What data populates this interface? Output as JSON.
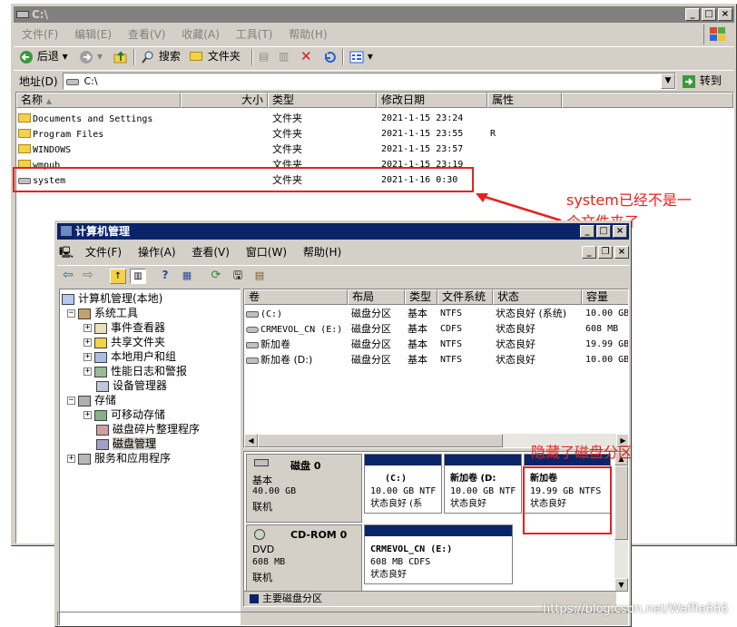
{
  "explorer": {
    "title": "C:\\",
    "menu": [
      "文件(F)",
      "编辑(E)",
      "查看(V)",
      "收藏(A)",
      "工具(T)",
      "帮助(H)"
    ],
    "toolbar": {
      "back": "后退",
      "search": "搜索",
      "folders": "文件夹"
    },
    "address_label": "地址(D)",
    "address_value": "C:\\",
    "go_label": "转到",
    "columns": [
      "名称",
      "大小",
      "类型",
      "修改日期",
      "属性"
    ],
    "rows": [
      {
        "name": "Documents and Settings",
        "size": "",
        "type": "文件夹",
        "date": "2021-1-15 23:24",
        "attr": ""
      },
      {
        "name": "Program Files",
        "size": "",
        "type": "文件夹",
        "date": "2021-1-15 23:55",
        "attr": "R"
      },
      {
        "name": "WINDOWS",
        "size": "",
        "type": "文件夹",
        "date": "2021-1-15 23:57",
        "attr": ""
      },
      {
        "name": "wmpub",
        "size": "",
        "type": "文件夹",
        "date": "2021-1-15 23:19",
        "attr": ""
      },
      {
        "name": "system",
        "size": "",
        "type": "文件夹",
        "date": "2021-1-16 0:30",
        "attr": ""
      }
    ]
  },
  "annotations": {
    "system_note_line1": "system已经不是一",
    "system_note_line2": "个文件夹了",
    "hidden_note": "隐藏了磁盘分区",
    "watermark": "https://blog.csdn.net/Waffle666"
  },
  "compmgmt": {
    "title": "计算机管理",
    "menu": [
      "文件(F)",
      "操作(A)",
      "查看(V)",
      "窗口(W)",
      "帮助(H)"
    ],
    "tree": [
      {
        "label": "计算机管理(本地)",
        "level": 0,
        "expander": ""
      },
      {
        "label": "系统工具",
        "level": 1,
        "expander": "−"
      },
      {
        "label": "事件查看器",
        "level": 2,
        "expander": "+"
      },
      {
        "label": "共享文件夹",
        "level": 2,
        "expander": "+"
      },
      {
        "label": "本地用户和组",
        "level": 2,
        "expander": "+"
      },
      {
        "label": "性能日志和警报",
        "level": 2,
        "expander": "+"
      },
      {
        "label": "设备管理器",
        "level": 2,
        "expander": ""
      },
      {
        "label": "存储",
        "level": 1,
        "expander": "−"
      },
      {
        "label": "可移动存储",
        "level": 2,
        "expander": "+"
      },
      {
        "label": "磁盘碎片整理程序",
        "level": 2,
        "expander": ""
      },
      {
        "label": "磁盘管理",
        "level": 2,
        "expander": ""
      },
      {
        "label": "服务和应用程序",
        "level": 1,
        "expander": "+"
      }
    ],
    "volume_columns": [
      "卷",
      "布局",
      "类型",
      "文件系统",
      "状态",
      "容量"
    ],
    "volumes": [
      {
        "name": "(C:)",
        "layout": "磁盘分区",
        "type": "基本",
        "fs": "NTFS",
        "status": "状态良好 (系统)",
        "cap": "10.00 GB"
      },
      {
        "name": "CRMEVOL_CN (E:)",
        "layout": "磁盘分区",
        "type": "基本",
        "fs": "CDFS",
        "status": "状态良好",
        "cap": "608 MB"
      },
      {
        "name": "新加卷",
        "layout": "磁盘分区",
        "type": "基本",
        "fs": "NTFS",
        "status": "状态良好",
        "cap": "19.99 GB"
      },
      {
        "name": "新加卷 (D:)",
        "layout": "磁盘分区",
        "type": "基本",
        "fs": "NTFS",
        "status": "状态良好",
        "cap": "10.00 GB"
      }
    ],
    "disks": [
      {
        "label": "磁盘 0",
        "kind": "基本",
        "size": "40.00 GB",
        "state": "联机",
        "partitions": [
          {
            "name": "(C:)",
            "size": "10.00 GB NTF",
            "status": "状态良好 (系"
          },
          {
            "name": "新加卷 (D:",
            "size": "10.00 GB NTF",
            "status": "状态良好"
          },
          {
            "name": "新加卷",
            "size": "19.99 GB NTFS",
            "status": "状态良好"
          }
        ]
      },
      {
        "label": "CD-ROM 0",
        "kind": "DVD",
        "size": "608 MB",
        "state": "联机",
        "partitions": [
          {
            "name": "CRMEVOL_CN (E:)",
            "size": "608 MB CDFS",
            "status": "状态良好"
          }
        ]
      }
    ],
    "legend": "主要磁盘分区",
    "colors": {
      "primary_partition": "#0a246a"
    }
  }
}
